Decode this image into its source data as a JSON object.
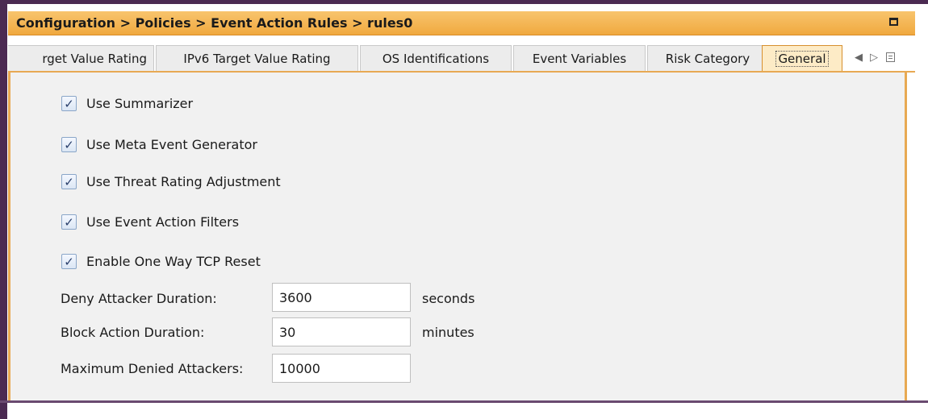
{
  "title_bar": {
    "breadcrumb": "Configuration > Policies > Event Action Rules > rules0",
    "maximize_icon": "maximize-icon"
  },
  "tabs": [
    {
      "label": "rget Value Rating",
      "active": false
    },
    {
      "label": "IPv6 Target Value Rating",
      "active": false
    },
    {
      "label": "OS Identifications",
      "active": false
    },
    {
      "label": "Event Variables",
      "active": false
    },
    {
      "label": "Risk Category",
      "active": false
    },
    {
      "label": "General",
      "active": true
    }
  ],
  "tab_controls": {
    "prev_icon": "◀",
    "next_icon": "▷",
    "list_icon": "tab-list-icon"
  },
  "general": {
    "checkboxes": [
      {
        "label": "Use Summarizer",
        "checked": true
      },
      {
        "label": "Use Meta Event Generator",
        "checked": true
      },
      {
        "label": "Use Threat Rating Adjustment",
        "checked": true
      },
      {
        "label": "Use Event Action Filters",
        "checked": true
      },
      {
        "label": "Enable One Way TCP Reset",
        "checked": true
      }
    ],
    "check_glyph": "✓",
    "fields": [
      {
        "label": "Deny Attacker Duration:",
        "value": "3600",
        "unit": "seconds"
      },
      {
        "label": "Block Action Duration:",
        "value": "30",
        "unit": "minutes"
      },
      {
        "label": "Maximum Denied Attackers:",
        "value": "10000",
        "unit": ""
      }
    ]
  },
  "colors": {
    "title_bar": "#f0a93f",
    "active_tab": "#fdebc6",
    "accent_border": "#e8a953",
    "panel_background": "#f1f1f1",
    "frame": "#4b2a52"
  }
}
